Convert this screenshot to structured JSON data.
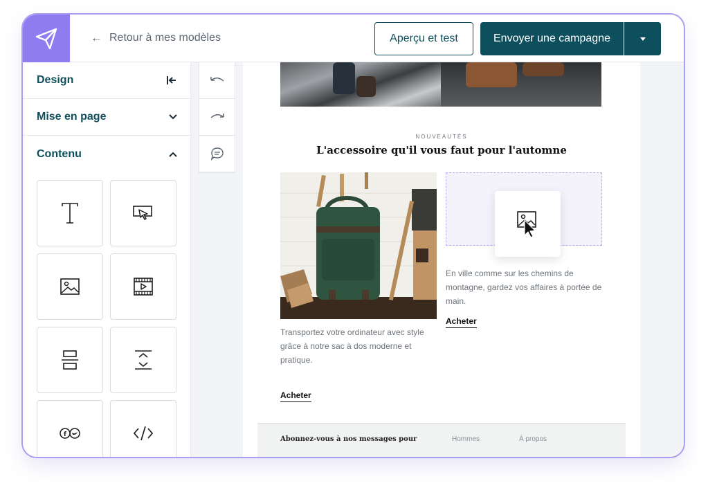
{
  "header": {
    "back_label": "Retour à mes modèles",
    "preview_label": "Aperçu et test",
    "send_label": "Envoyer une campagne"
  },
  "sidebar": {
    "sections": [
      {
        "label": "Design",
        "icon": "collapse-left-icon"
      },
      {
        "label": "Mise en page",
        "icon": "chevron-down-icon"
      },
      {
        "label": "Contenu",
        "icon": "chevron-up-icon"
      }
    ],
    "blocks": [
      {
        "name": "text-block",
        "icon": "text-icon"
      },
      {
        "name": "button-block",
        "icon": "cursor-button-icon"
      },
      {
        "name": "image-block",
        "icon": "image-icon"
      },
      {
        "name": "video-block",
        "icon": "video-icon"
      },
      {
        "name": "divider-block",
        "icon": "divider-icon"
      },
      {
        "name": "spacer-block",
        "icon": "spacer-icon"
      },
      {
        "name": "social-block",
        "icon": "social-icon"
      },
      {
        "name": "html-block",
        "icon": "code-icon"
      }
    ]
  },
  "tools": [
    "undo-icon",
    "redo-icon",
    "comment-icon"
  ],
  "email": {
    "kicker": "NOUVEAUTÉS",
    "headline": "L'accessoire qu'il vous faut pour l'automne",
    "product1": {
      "description": "Transportez votre ordinateur avec style grâce à notre sac à dos moderne et pratique.",
      "cta": "Acheter"
    },
    "product2": {
      "description": "En ville comme sur les chemins de montagne, gardez vos affaires à portée de main.",
      "cta": "Acheter"
    },
    "footer": {
      "subscribe": "Abonnez-vous à nos messages pour",
      "link1": "Hommes",
      "link2": "À propos"
    }
  },
  "colors": {
    "brand": "#8f7cf0",
    "primary": "#0e4f5d"
  }
}
